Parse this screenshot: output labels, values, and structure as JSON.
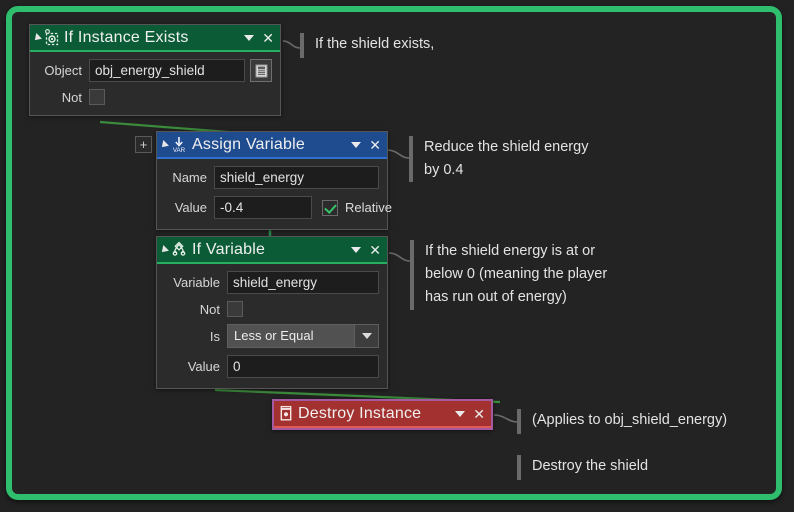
{
  "editor": {
    "background_color": "#222222",
    "selection_frame_color": "#2fbd6e",
    "panel_color": "#232323"
  },
  "blocks": [
    {
      "id": "if-instance-exists",
      "title": "If Instance Exists",
      "icon": "instance-exists-icon",
      "header_color": "#0b5c36",
      "accent_color": "#27b062",
      "caret_icon": "chevron-down-icon",
      "close_icon": "close-icon",
      "collapse_icon": "collapse-triangle-icon",
      "fields": [
        {
          "label": "Object",
          "value": "obj_energy_shield",
          "type": "text",
          "menu_icon": "list-menu-icon"
        },
        {
          "label": "Not",
          "value": "",
          "type": "checkbox",
          "checked": false
        }
      ]
    },
    {
      "id": "assign-variable",
      "title": "Assign Variable",
      "icon": "assign-var-icon",
      "header_color": "#1f4b8f",
      "accent_color": "#2f6fd0",
      "caret_icon": "chevron-down-icon",
      "close_icon": "close-icon",
      "collapse_icon": "collapse-triangle-icon",
      "add_button_label": "+",
      "fields": [
        {
          "label": "Name",
          "value": "shield_energy",
          "type": "text"
        },
        {
          "label": "Value",
          "value": "-0.4",
          "type": "text",
          "checkbox_label": "Relative",
          "checked": true
        }
      ]
    },
    {
      "id": "if-variable",
      "title": "If Variable",
      "icon": "if-variable-icon",
      "header_color": "#0b5c36",
      "accent_color": "#27b062",
      "caret_icon": "chevron-down-icon",
      "close_icon": "close-icon",
      "collapse_icon": "collapse-triangle-icon",
      "fields": [
        {
          "label": "Variable",
          "value": "shield_energy",
          "type": "text"
        },
        {
          "label": "Not",
          "value": "",
          "type": "checkbox",
          "checked": false
        },
        {
          "label": "Is",
          "value": "Less or Equal",
          "type": "combo"
        },
        {
          "label": "Value",
          "value": "0",
          "type": "text"
        }
      ]
    },
    {
      "id": "destroy-instance",
      "title": "Destroy Instance",
      "icon": "trash-icon",
      "header_color": "#a2312f",
      "accent_color": "#e05b58",
      "caret_icon": "chevron-down-icon",
      "close_icon": "close-icon",
      "selected": true,
      "selection_outline_color": "#a559a0",
      "fields": []
    }
  ],
  "annotations": [
    {
      "id": "anno-1",
      "text": "If the shield exists,"
    },
    {
      "id": "anno-2",
      "text": "Reduce the shield energy\nby 0.4"
    },
    {
      "id": "anno-3",
      "text": "If the shield energy is at or\nbelow 0 (meaning the player\nhas run out of energy)"
    },
    {
      "id": "anno-4",
      "text": "(Applies to obj_shield_energy)"
    },
    {
      "id": "anno-5",
      "text": "Destroy the shield"
    }
  ]
}
